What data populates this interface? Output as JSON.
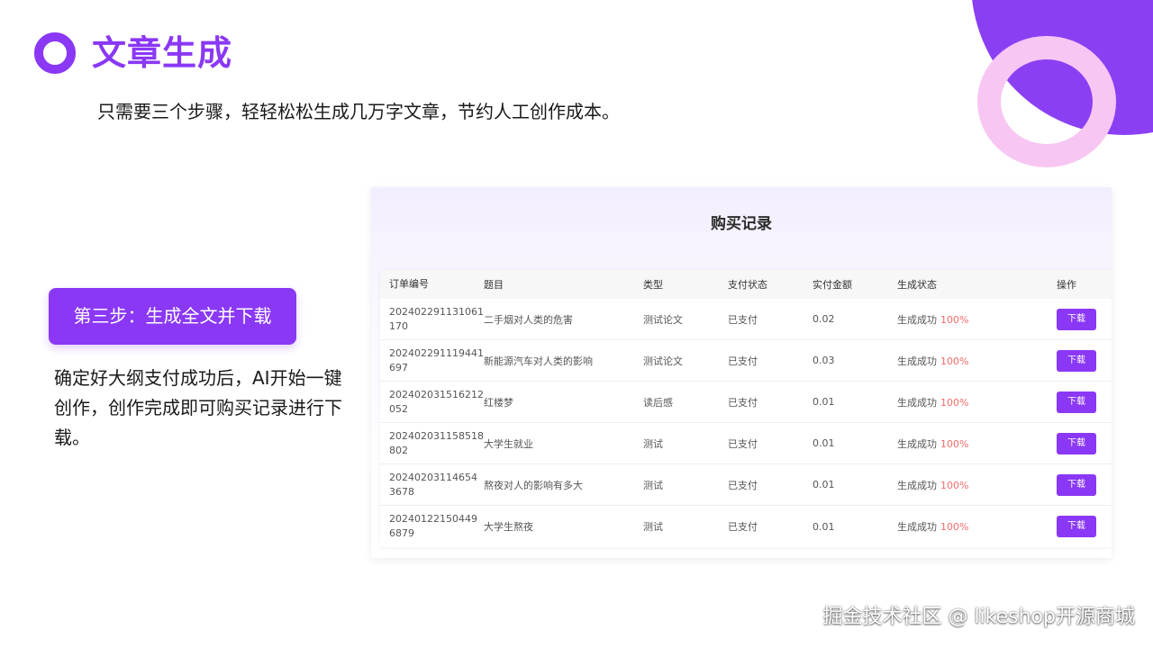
{
  "header": {
    "title": "文章生成",
    "subtitle": "只需要三个步骤，轻轻松松生成几万字文章，节约人工创作成本。"
  },
  "step": {
    "label": "第三步：生成全文并下载",
    "description": "确定好大纲支付成功后，AI开始一键创作，创作完成即可购买记录进行下载。"
  },
  "record": {
    "title": "购买记录",
    "columns": [
      "订单编号",
      "题目",
      "类型",
      "支付状态",
      "实付金额",
      "生成状态",
      "操作"
    ],
    "rows": [
      {
        "id_line1": "202402291131061",
        "id_line2": "170",
        "topic": "二手烟对人类的危害",
        "type": "测试论文",
        "pay": "已支付",
        "amount": "0.02",
        "gen": "生成成功",
        "pct": "100%",
        "action": "下载"
      },
      {
        "id_line1": "202402291119441",
        "id_line2": "697",
        "topic": "新能源汽车对人类的影响",
        "type": "测试论文",
        "pay": "已支付",
        "amount": "0.03",
        "gen": "生成成功",
        "pct": "100%",
        "action": "下载"
      },
      {
        "id_line1": "202402031516212",
        "id_line2": "052",
        "topic": "红楼梦",
        "type": "读后感",
        "pay": "已支付",
        "amount": "0.01",
        "gen": "生成成功",
        "pct": "100%",
        "action": "下载"
      },
      {
        "id_line1": "202402031158518",
        "id_line2": "802",
        "topic": "大学生就业",
        "type": "测试",
        "pay": "已支付",
        "amount": "0.01",
        "gen": "生成成功",
        "pct": "100%",
        "action": "下载"
      },
      {
        "id_line1": "20240203114654",
        "id_line2": "3678",
        "topic": "熬夜对人的影响有多大",
        "type": "测试",
        "pay": "已支付",
        "amount": "0.01",
        "gen": "生成成功",
        "pct": "100%",
        "action": "下载"
      },
      {
        "id_line1": "20240122150449",
        "id_line2": "6879",
        "topic": "大学生熬夜",
        "type": "测试",
        "pay": "已支付",
        "amount": "0.01",
        "gen": "生成成功",
        "pct": "100%",
        "action": "下载"
      }
    ]
  },
  "watermark": "掘金技术社区 @ likeshop开源商城",
  "colors": {
    "accent": "#8a38f5",
    "ring_pink": "#f7c6f3",
    "percent_red": "#f56c6c"
  }
}
